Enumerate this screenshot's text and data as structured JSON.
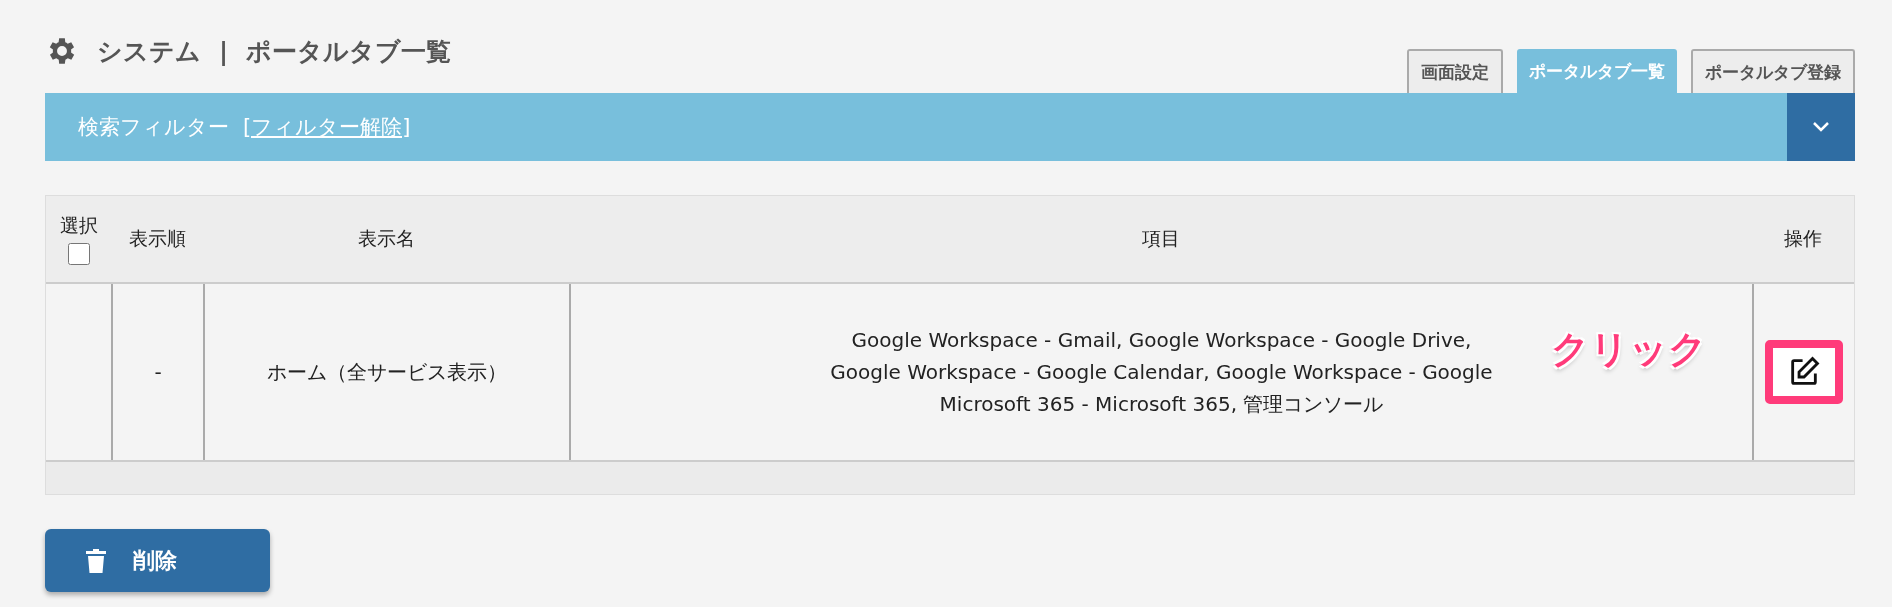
{
  "header": {
    "title": "システム",
    "separator": "|",
    "subtitle": "ポータルタブ一覧"
  },
  "tabs": [
    {
      "label": "画面設定",
      "selected": false
    },
    {
      "label": "ポータルタブ一覧",
      "selected": true
    },
    {
      "label": "ポータルタブ登録",
      "selected": false
    }
  ],
  "filter": {
    "label": "検索フィルター",
    "clear_link": "[フィルター解除]",
    "expanded": false
  },
  "table": {
    "columns": [
      "選択",
      "表示順",
      "表示名",
      "項目",
      "操作"
    ],
    "select_all_checked": false,
    "rows": [
      {
        "order": "-",
        "name": "ホーム（全サービス表示）",
        "items": [
          "Google Workspace - Gmail, Google Workspace - Google Drive,",
          "Google Workspace - Google Calendar, Google Workspace - Google",
          "Microsoft 365 - Microsoft 365, 管理コンソール"
        ]
      }
    ]
  },
  "annotation": {
    "text": "クリック"
  },
  "delete_button": {
    "label": "削除"
  }
}
